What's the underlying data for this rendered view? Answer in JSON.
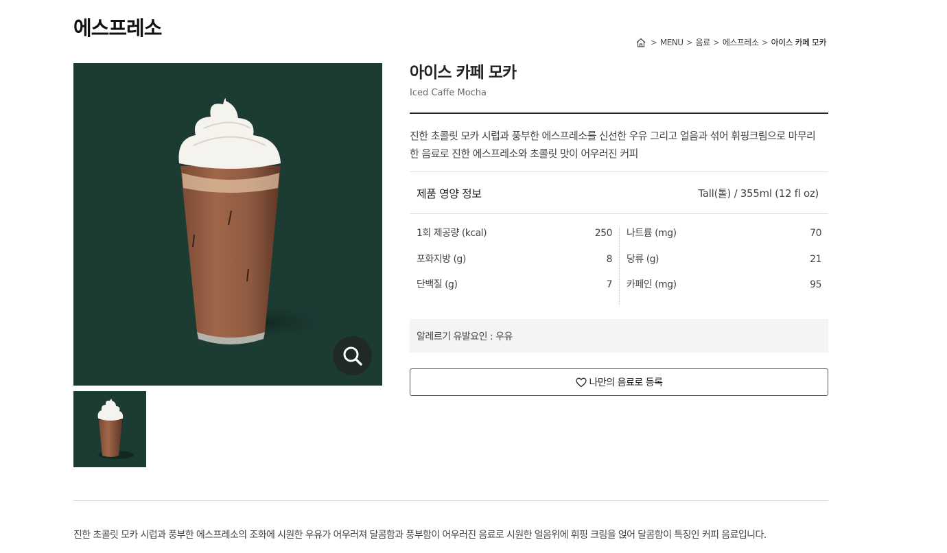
{
  "page": {
    "title": "에스프레소"
  },
  "breadcrumb": {
    "items": [
      "MENU",
      "음료",
      "에스프레소",
      "아이스 카페 모카"
    ]
  },
  "product": {
    "name": "아이스 카페 모카",
    "name_en": "Iced Caffe Mocha",
    "description": "진한 초콜릿 모카 시럽과 풍부한 에스프레소를 신선한 우유 그리고 얼음과 섞어 휘핑크림으로 마무리한 음료로 진한 에스프레소와 초콜릿 맛이 어우러진 커피"
  },
  "nutrition": {
    "title": "제품 영양 정보",
    "size": "Tall(톨) / 355ml (12 fl oz)",
    "left": [
      {
        "label": "1회 제공량 (kcal)",
        "value": "250"
      },
      {
        "label": "포화지방 (g)",
        "value": "8"
      },
      {
        "label": "단백질 (g)",
        "value": "7"
      }
    ],
    "right": [
      {
        "label": "나트륨 (mg)",
        "value": "70"
      },
      {
        "label": "당류 (g)",
        "value": "21"
      },
      {
        "label": "카페인 (mg)",
        "value": "95"
      }
    ]
  },
  "allergy": {
    "text": "알레르기 유발요인 : 우유"
  },
  "favorite": {
    "label": "나만의 음료로 등록"
  },
  "bottom": {
    "description": "진한 초콜릿 모카 시럽과 풍부한 에스프레소의 조화에 시원한 우유가 어우러져 달콤함과 풍부함이 어우러진 음료로 시원한 얼음위에 휘핑 크림을 얹어 달콤함이 특징인 커피 음료입니다."
  },
  "icons": {
    "home": "home-icon",
    "zoom": "magnifier-icon",
    "heart": "heart-icon"
  },
  "colors": {
    "hero_bg": "#1c3b33",
    "zoom_bg": "#1f2a27",
    "allergy_bg": "#f4f4f2"
  }
}
